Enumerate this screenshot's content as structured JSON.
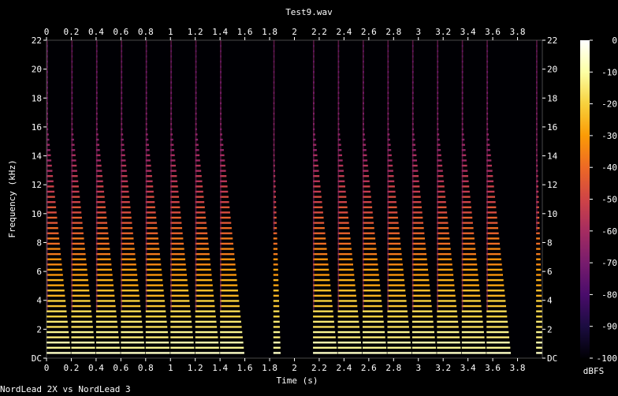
{
  "chart_data": {
    "type": "heatmap",
    "title": "Test9.wav",
    "xlabel": "Time (s)",
    "ylabel": "Frequency (kHz)",
    "xlim": [
      0,
      4.0
    ],
    "ylim": [
      0,
      22
    ],
    "x_ticks": [
      "0",
      "0.2",
      "0.4",
      "0.6",
      "0.8",
      "1",
      "1.2",
      "1.4",
      "1.6",
      "1.8",
      "2",
      "2.2",
      "2.4",
      "2.6",
      "2.8",
      "3",
      "3.2",
      "3.4",
      "3.6",
      "3.8"
    ],
    "y_ticks": [
      "DC",
      "2",
      "4",
      "6",
      "8",
      "10",
      "12",
      "14",
      "16",
      "18",
      "20",
      "22"
    ],
    "colorbar": {
      "label": "dBFS",
      "range": [
        -100,
        0
      ],
      "ticks": [
        "0",
        "-10",
        "-20",
        "-30",
        "-40",
        "-50",
        "-60",
        "-70",
        "-80",
        "-90",
        "-100"
      ],
      "colormap": [
        "#000004",
        "#1b0c41",
        "#4a0c6b",
        "#781c6d",
        "#a52c60",
        "#cf4446",
        "#ed6925",
        "#fb9b06",
        "#f7d13d",
        "#fcffa4",
        "#ffffff"
      ]
    },
    "notes": [
      {
        "t": 0.0,
        "decay": 1.0
      },
      {
        "t": 0.2,
        "decay": 1.0
      },
      {
        "t": 0.4,
        "decay": 1.0
      },
      {
        "t": 0.6,
        "decay": 1.0
      },
      {
        "t": 0.8,
        "decay": 1.0
      },
      {
        "t": 1.0,
        "decay": 1.0
      },
      {
        "t": 1.2,
        "decay": 1.0
      },
      {
        "t": 1.4,
        "decay": 1.0
      },
      {
        "t": 1.83,
        "decay": 0.3
      },
      {
        "t": 2.15,
        "decay": 1.0
      },
      {
        "t": 2.35,
        "decay": 1.0
      },
      {
        "t": 2.55,
        "decay": 1.0
      },
      {
        "t": 2.75,
        "decay": 1.0
      },
      {
        "t": 2.95,
        "decay": 1.0
      },
      {
        "t": 3.15,
        "decay": 1.0
      },
      {
        "t": 3.35,
        "decay": 1.0
      },
      {
        "t": 3.55,
        "decay": 1.0
      },
      {
        "t": 3.95,
        "decay": 0.3
      }
    ]
  },
  "footer": "NordLead 2X vs NordLead 3"
}
